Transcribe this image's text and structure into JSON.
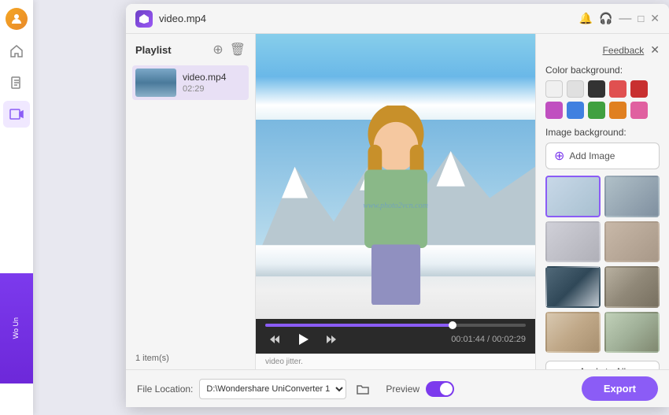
{
  "app": {
    "title": "video.mp4",
    "icon_text": "W"
  },
  "window_controls": {
    "minimize": "—",
    "maximize": "□",
    "close": "✕"
  },
  "top_bar": {
    "feedback_label": "Feedback",
    "close_label": "✕"
  },
  "playlist": {
    "title": "Playlist",
    "items": [
      {
        "name": "video.mp4",
        "duration": "02:29"
      }
    ],
    "footer": "1 item(s)"
  },
  "video": {
    "watermark": "www.photo2vcn.com",
    "time_current": "00:01:44",
    "time_total": "00:02:29",
    "time_display": "00:01:44 / 00:02:29",
    "progress_percent": 72
  },
  "right_panel": {
    "color_background_label": "Color background:",
    "image_background_label": "Image background:",
    "add_image_label": "Add Image",
    "apply_all_label": "Apply to All",
    "colors": [
      {
        "value": "#f0f0f0",
        "name": "white"
      },
      {
        "value": "#e0e0e0",
        "name": "light-gray"
      },
      {
        "value": "#333333",
        "name": "black"
      },
      {
        "value": "#e05050",
        "name": "red"
      },
      {
        "value": "#c83030",
        "name": "dark-red"
      },
      {
        "value": "#c050c0",
        "name": "purple"
      },
      {
        "value": "#4080e0",
        "name": "blue"
      },
      {
        "value": "#40a040",
        "name": "green"
      },
      {
        "value": "#e08020",
        "name": "orange"
      },
      {
        "value": "#e060a0",
        "name": "pink"
      }
    ],
    "images": [
      {
        "id": 1,
        "class": "img-t1",
        "selected": true
      },
      {
        "id": 2,
        "class": "img-t2",
        "selected": false
      },
      {
        "id": 3,
        "class": "img-t3",
        "selected": false
      },
      {
        "id": 4,
        "class": "img-t4",
        "selected": false
      },
      {
        "id": 5,
        "class": "img-t5",
        "selected": false
      },
      {
        "id": 6,
        "class": "img-t6",
        "selected": false
      },
      {
        "id": 7,
        "class": "img-t7",
        "selected": false
      },
      {
        "id": 8,
        "class": "img-t8",
        "selected": false
      }
    ]
  },
  "bottom_bar": {
    "file_location_label": "File Location:",
    "file_path": "D:\\Wondershare UniConverter 1",
    "preview_label": "Preview",
    "toggle_on": true,
    "export_label": "Export"
  },
  "sidebar": {
    "icons": [
      "🏠",
      "📁",
      "🎬"
    ]
  },
  "promo": {
    "text": "Wo\nUn"
  },
  "tip_bar": {
    "text": "video jitter."
  }
}
